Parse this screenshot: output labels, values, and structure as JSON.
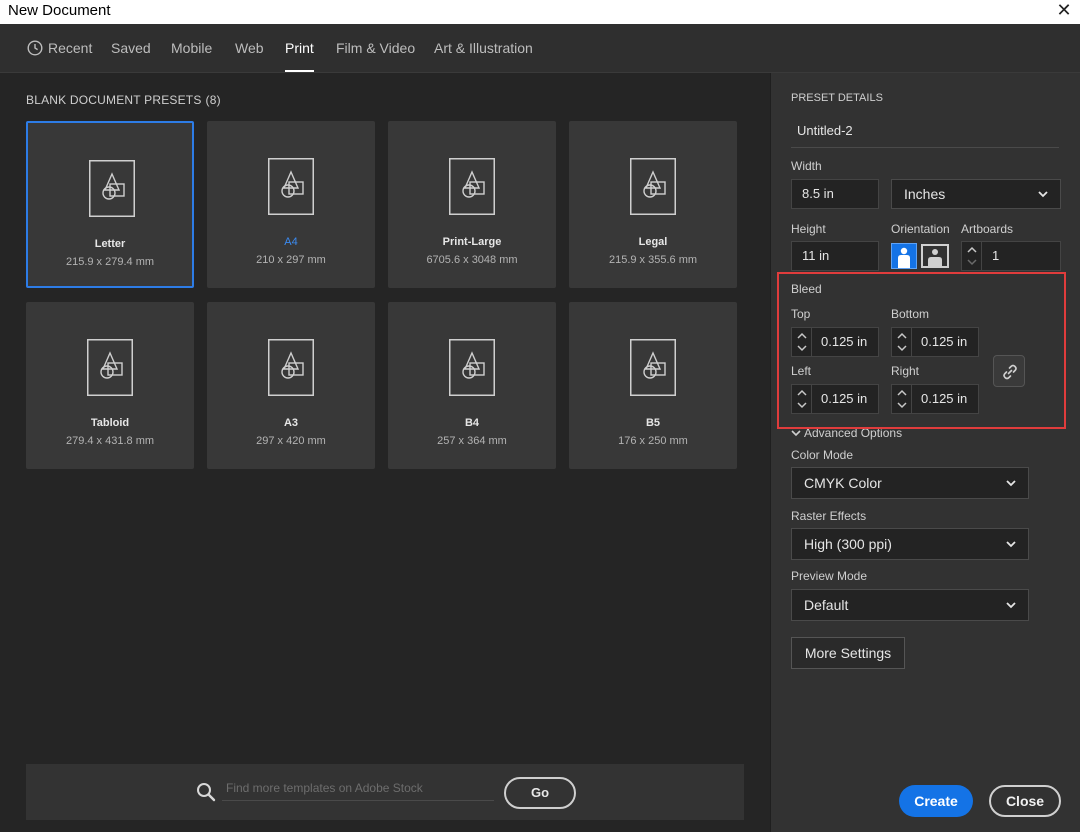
{
  "window": {
    "title": "New Document",
    "close_glyph": "✕"
  },
  "tabs": [
    {
      "label": "Recent",
      "icon": "clock-icon"
    },
    {
      "label": "Saved"
    },
    {
      "label": "Mobile"
    },
    {
      "label": "Web"
    },
    {
      "label": "Print",
      "active": true
    },
    {
      "label": "Film & Video"
    },
    {
      "label": "Art & Illustration"
    }
  ],
  "presets": {
    "heading": "BLANK DOCUMENT PRESETS",
    "count": "(8)",
    "items": [
      {
        "name": "Letter",
        "dims": "215.9 x 279.4 mm",
        "selected": true
      },
      {
        "name": "A4",
        "dims": "210 x 297 mm"
      },
      {
        "name": "Print-Large",
        "dims": "6705.6 x 3048 mm"
      },
      {
        "name": "Legal",
        "dims": "215.9 x 355.6 mm"
      },
      {
        "name": "Tabloid",
        "dims": "279.4 x 431.8 mm"
      },
      {
        "name": "A3",
        "dims": "297 x 420 mm"
      },
      {
        "name": "B4",
        "dims": "257 x 364 mm"
      },
      {
        "name": "B5",
        "dims": "176 x 250 mm"
      }
    ]
  },
  "search": {
    "placeholder": "Find more templates on Adobe Stock",
    "go_label": "Go"
  },
  "details": {
    "heading": "PRESET DETAILS",
    "doc_name": "Untitled-2",
    "width_label": "Width",
    "width_value": "8.5 in",
    "units": "Inches",
    "height_label": "Height",
    "height_value": "11 in",
    "orientation_label": "Orientation",
    "artboards_label": "Artboards",
    "artboards_value": "1",
    "bleed": {
      "label": "Bleed",
      "top_label": "Top",
      "top_value": "0.125 in",
      "bottom_label": "Bottom",
      "bottom_value": "0.125 in",
      "left_label": "Left",
      "left_value": "0.125 in",
      "right_label": "Right",
      "right_value": "0.125 in"
    },
    "advanced_label": "Advanced Options",
    "color_mode_label": "Color Mode",
    "color_mode_value": "CMYK Color",
    "raster_label": "Raster Effects",
    "raster_value": "High (300 ppi)",
    "preview_label": "Preview Mode",
    "preview_value": "Default",
    "more_settings": "More Settings",
    "create": "Create",
    "close": "Close"
  },
  "colors": {
    "accent": "#1473e6",
    "selected_border": "#2d7ce6",
    "highlight": "#e03c3c",
    "portrait_active": "#1473e6"
  }
}
